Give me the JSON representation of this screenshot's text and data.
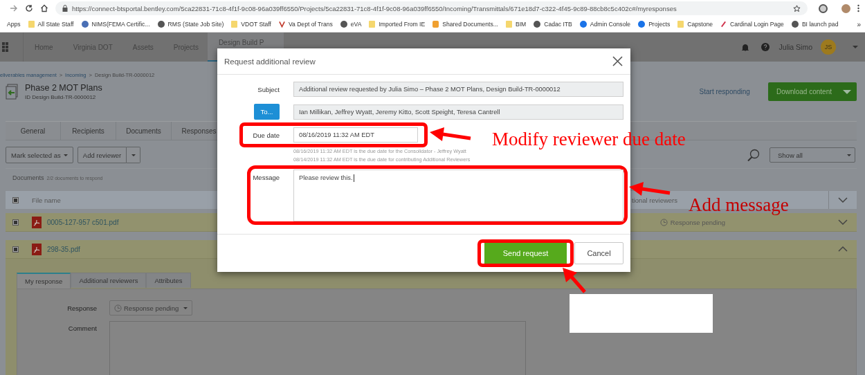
{
  "browser": {
    "url": "https://connect-btsportal.bentley.com/5ca22831-71c8-4f1f-9c08-96a039ff6550/Projects/5ca22831-71c8-4f1f-9c08-96a039ff6550/Incoming/Transmittals/671e18d7-c322-4f45-9c89-88cb8c5c402c#/myresponses",
    "overflow": "»",
    "bookmarks": [
      {
        "label": "Apps",
        "kind": "none"
      },
      {
        "label": "All State Staff",
        "kind": "folder"
      },
      {
        "label": "NIMS(FEMA Certific...",
        "kind": "seal"
      },
      {
        "label": "RMS (State Job Site)",
        "kind": "globe"
      },
      {
        "label": "VDOT Staff",
        "kind": "folder"
      },
      {
        "label": "Va Dept of Trans",
        "kind": "logo"
      },
      {
        "label": "eVA",
        "kind": "globe"
      },
      {
        "label": "Imported From IE",
        "kind": "folder"
      },
      {
        "label": "Shared Documents...",
        "kind": "app"
      },
      {
        "label": "BIM",
        "kind": "folder"
      },
      {
        "label": "Cadac ITB",
        "kind": "globe"
      },
      {
        "label": "Admin Console",
        "kind": "circle"
      },
      {
        "label": "Projects",
        "kind": "circle"
      },
      {
        "label": "Capstone",
        "kind": "folder"
      },
      {
        "label": "Cardinal Login Page",
        "kind": "pen"
      },
      {
        "label": "BI launch pad",
        "kind": "globe"
      }
    ]
  },
  "header": {
    "nav": [
      {
        "label": "Home",
        "selected": false
      },
      {
        "label": "Virginia DOT",
        "selected": false
      },
      {
        "label": "Assets",
        "selected": false
      },
      {
        "label": "Projects",
        "selected": false
      },
      {
        "label": "Design Build P",
        "selected": true
      }
    ],
    "user": "Julia Simo",
    "initials": "JS"
  },
  "breadcrumb": {
    "separator": ">",
    "items": [
      "eliverables management",
      "Incoming",
      "Design Build-TR-0000012"
    ]
  },
  "transmittal": {
    "title": "Phase 2 MOT Plans",
    "id": "ID Design Build-TR-0000012",
    "link": "Start responding",
    "button": "Download content"
  },
  "tabs": [
    {
      "label": "General",
      "selected": false
    },
    {
      "label": "Recipients",
      "selected": false
    },
    {
      "label": "Documents",
      "selected": false
    },
    {
      "label": "Responses",
      "selected": false
    }
  ],
  "toolbar": {
    "mark": "Mark selected as",
    "add": "Add reviewer",
    "filter": "Show all"
  },
  "documents": {
    "label": "Documents",
    "count": "2/2 documents to respond"
  },
  "table": {
    "all_checked": true,
    "columns": [
      "File name",
      "tional reviewers"
    ],
    "rows": [
      {
        "name": "0005-127-957 c501.pdf",
        "checked": true,
        "status": "Response pending",
        "expanded": false
      },
      {
        "name": "298-35.pdf",
        "checked": true,
        "expanded": true
      }
    ]
  },
  "detail": {
    "tabs": [
      {
        "label": "My response",
        "selected": true
      },
      {
        "label": "Additional reviewers",
        "selected": false
      },
      {
        "label": "Attributes",
        "selected": false
      }
    ],
    "response_label": "Response",
    "response_value": "Response pending",
    "comment_label": "Comment"
  },
  "dialog": {
    "title": "Request additional review",
    "subject_label": "Subject",
    "subject": "Additional review requested by Julia Simo – Phase 2 MOT Plans, Design Build-TR-0000012",
    "to_button": "To...",
    "to": "Ian Millikan, Jeffrey Wyatt, Jeremy Kitto, Scott Speight, Teresa Cantrell",
    "due_label": "Due date",
    "due": "08/16/2019 11:32 AM EDT",
    "hints": [
      "08/16/2019 11:32 AM EDT is the due date for the Consolidator - Jeffrey Wyatt",
      "08/14/2019 11:32 AM EDT is the due date for contributing Additional Reviewers"
    ],
    "message_label": "Message",
    "message": "Please review this.",
    "send": "Send request",
    "cancel": "Cancel"
  },
  "annotations": [
    "Modify reviewer due date",
    "Add message"
  ]
}
